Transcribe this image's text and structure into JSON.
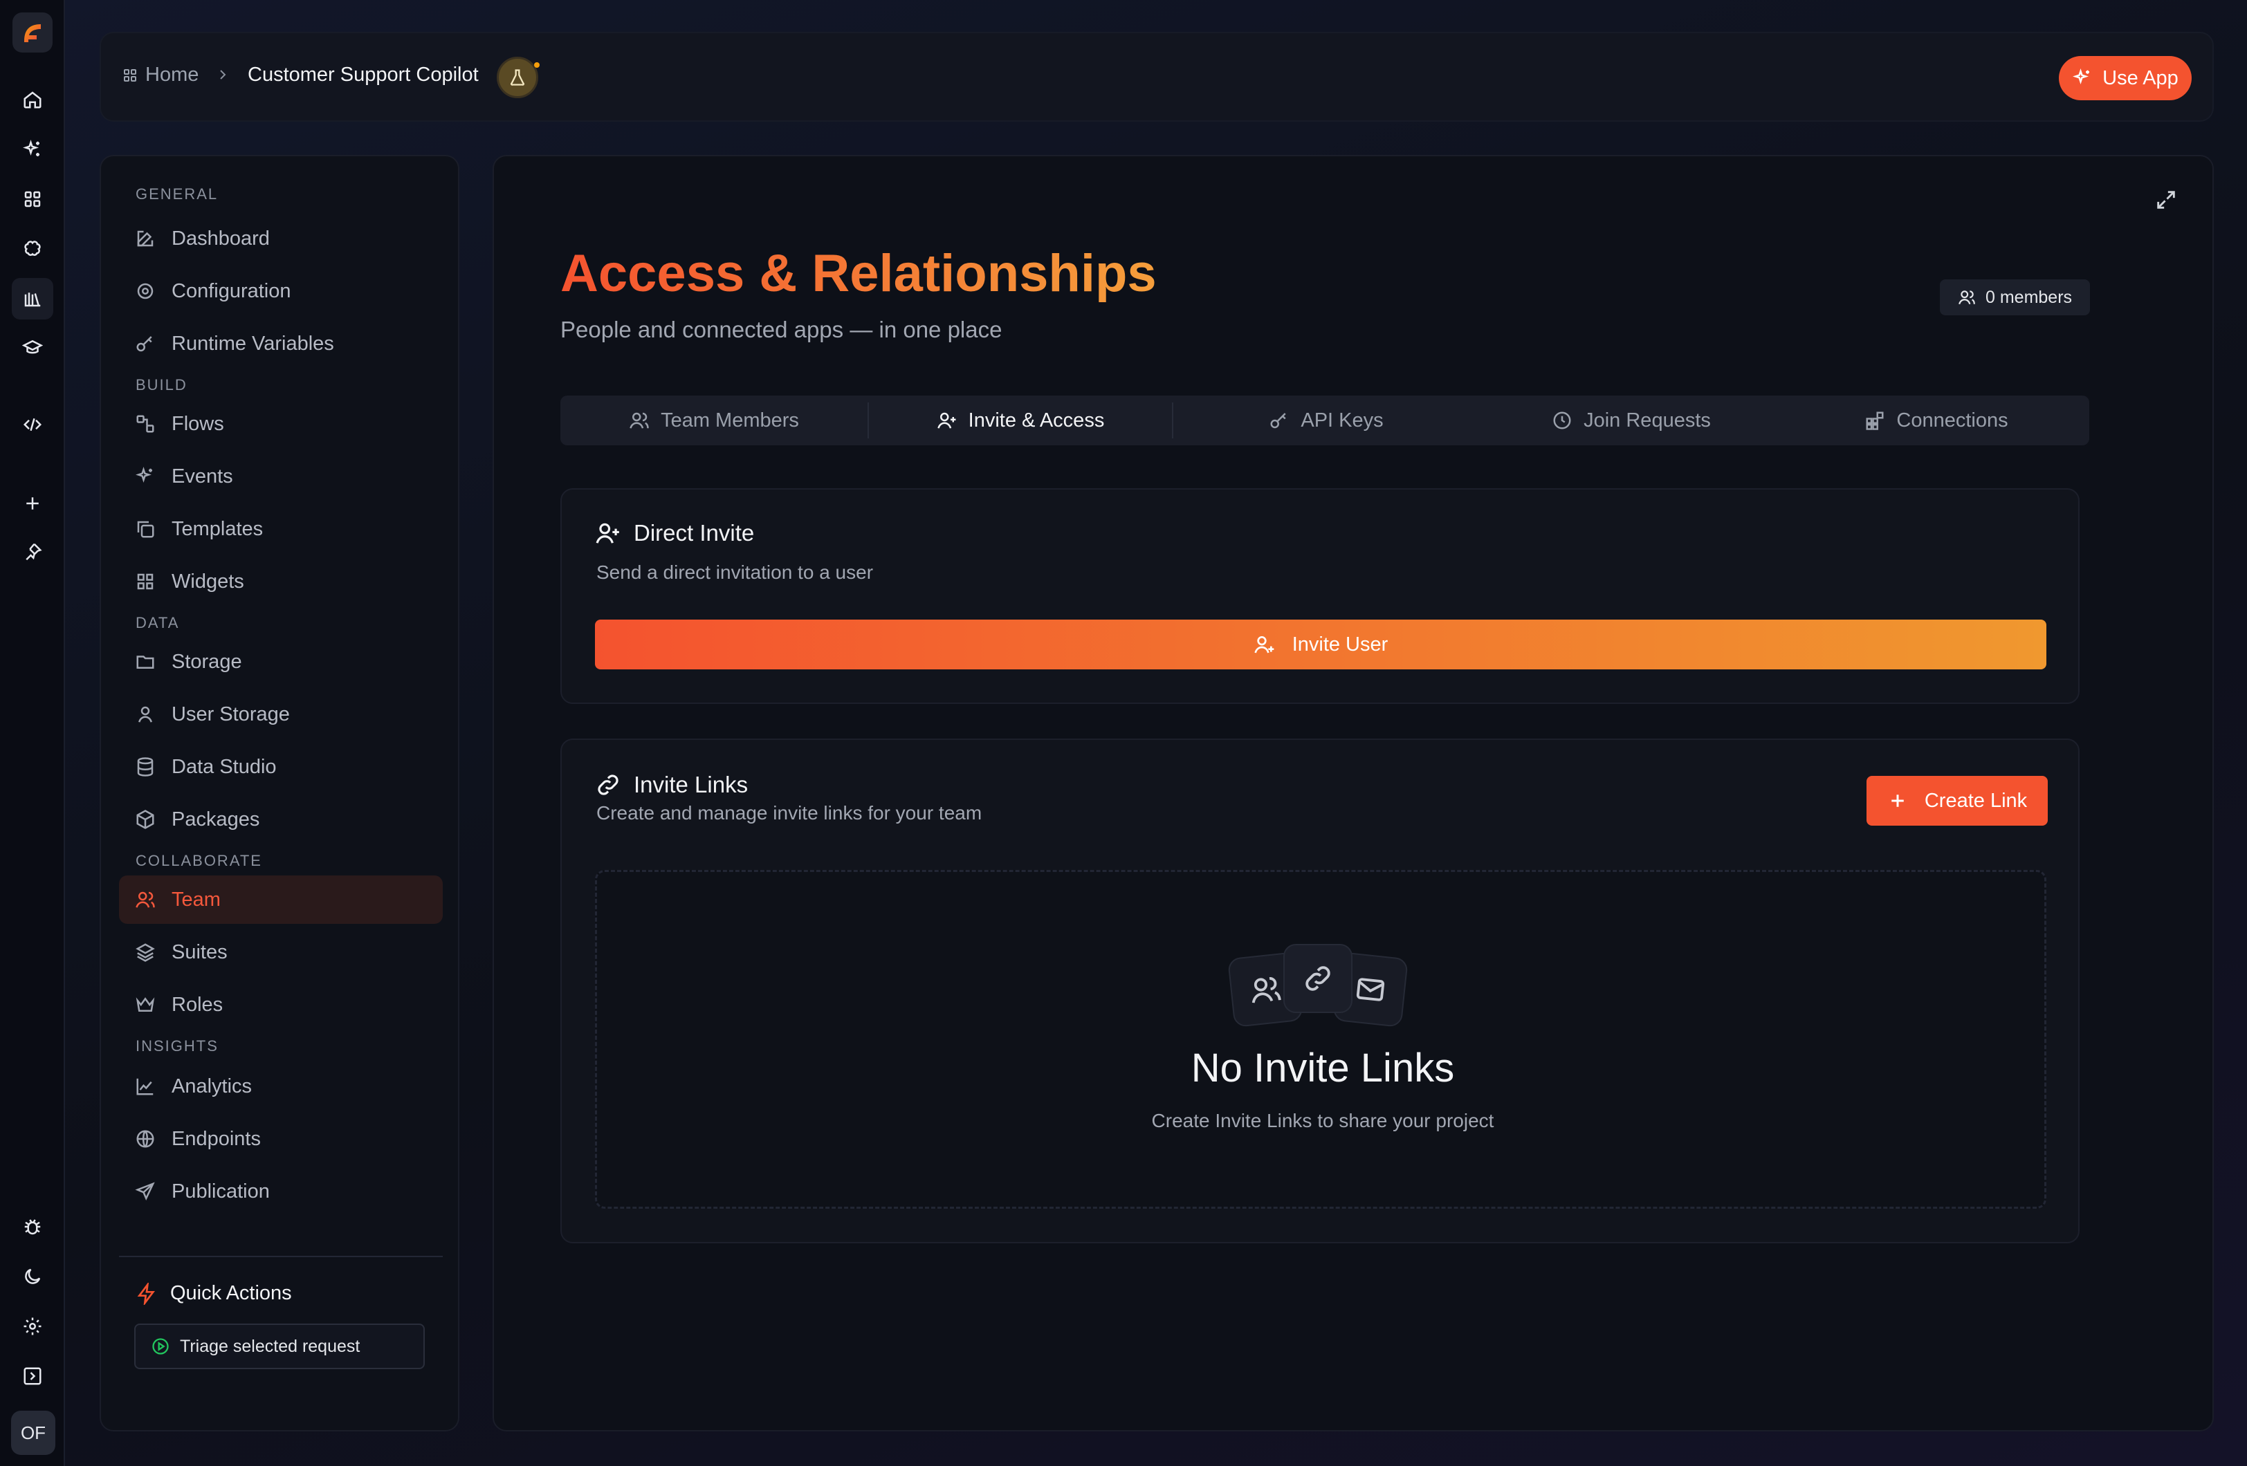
{
  "rail": {
    "avatar_initials": "OF"
  },
  "header": {
    "home_label": "Home",
    "current_label": "Customer Support Copilot",
    "use_app_label": "Use App"
  },
  "sidebar": {
    "sections": {
      "general": "GENERAL",
      "build": "BUILD",
      "data": "DATA",
      "collaborate": "COLLABORATE",
      "insights": "INSIGHTS"
    },
    "items": {
      "dashboard": "Dashboard",
      "configuration": "Configuration",
      "runtime_variables": "Runtime Variables",
      "flows": "Flows",
      "events": "Events",
      "templates": "Templates",
      "widgets": "Widgets",
      "storage": "Storage",
      "user_storage": "User Storage",
      "data_studio": "Data Studio",
      "packages": "Packages",
      "team": "Team",
      "suites": "Suites",
      "roles": "Roles",
      "analytics": "Analytics",
      "endpoints": "Endpoints",
      "publication": "Publication"
    },
    "active_item": "team",
    "quick_actions": {
      "title": "Quick Actions",
      "triage_label": "Triage selected request"
    }
  },
  "main": {
    "title": "Access & Relationships",
    "subtitle": "People and connected apps — in one place",
    "members_badge": "0 members",
    "tabs": {
      "team_members": "Team Members",
      "invite_access": "Invite & Access",
      "api_keys": "API Keys",
      "join_requests": "Join Requests",
      "connections": "Connections"
    },
    "active_tab": "invite_access",
    "direct_invite": {
      "title": "Direct Invite",
      "subtitle": "Send a direct invitation to a user",
      "button_label": "Invite User"
    },
    "invite_links": {
      "title": "Invite Links",
      "subtitle": "Create and manage invite links for your team",
      "create_label": "Create Link",
      "empty_title": "No Invite Links",
      "empty_subtitle": "Create Invite Links to share your project"
    }
  },
  "colors": {
    "accent": "#f4532f",
    "accent_gradient_end": "#f0982f",
    "background": "#0d1018",
    "quick_action_icon": "#22c55e"
  },
  "icons": {
    "rail": [
      "home-icon",
      "sparkles-icon",
      "apps-grid-icon",
      "brain-icon",
      "library-icon",
      "graduation-cap-icon",
      "code-icon",
      "plus-icon",
      "pin-icon",
      "bug-icon",
      "moon-icon",
      "gear-icon",
      "panel-toggle-icon"
    ]
  }
}
